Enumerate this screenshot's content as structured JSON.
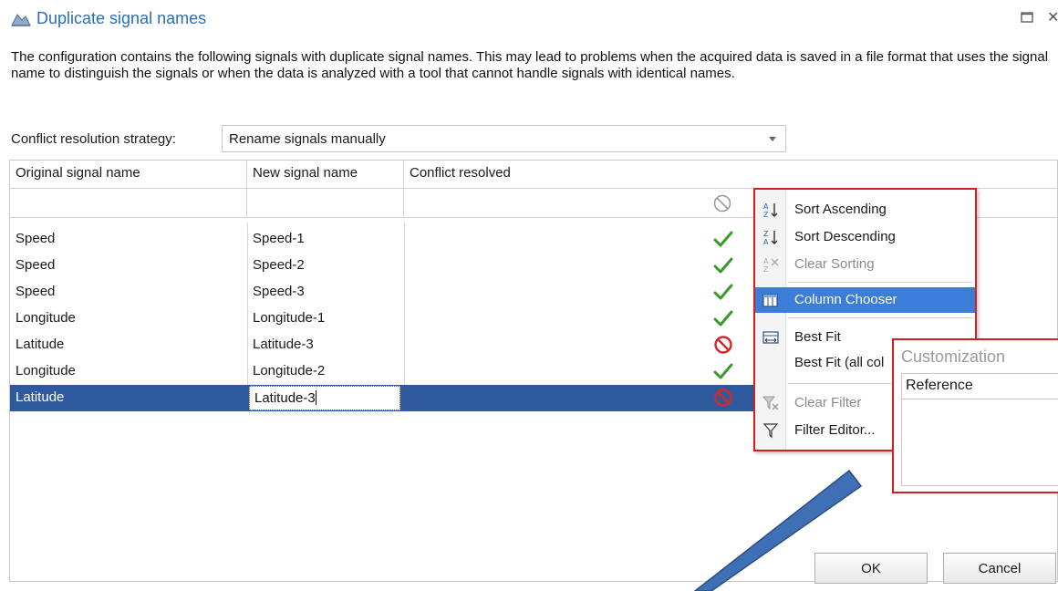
{
  "dialog": {
    "title": "Duplicate signal names",
    "description": "The configuration contains the following signals with duplicate signal names. This may lead to problems when the acquired data is saved in a file format that uses the signal name to distinguish the signals or when the data is analyzed with a tool that cannot handle signals with identical names."
  },
  "strategy": {
    "label": "Conflict resolution strategy:",
    "value": "Rename signals manually"
  },
  "grid": {
    "columns": [
      "Original signal name",
      "New signal name",
      "Conflict resolved"
    ],
    "rows": [
      {
        "original": "Speed",
        "new_name": "Speed-1",
        "resolved": "check"
      },
      {
        "original": "Speed",
        "new_name": "Speed-2",
        "resolved": "check"
      },
      {
        "original": "Speed",
        "new_name": "Speed-3",
        "resolved": "check"
      },
      {
        "original": "Longitude",
        "new_name": "Longitude-1",
        "resolved": "check"
      },
      {
        "original": "Latitude",
        "new_name": "Latitude-3",
        "resolved": "prohibited"
      },
      {
        "original": "Longitude",
        "new_name": "Longitude-2",
        "resolved": "check"
      },
      {
        "original": "Latitude",
        "new_name": "Latitude-3",
        "resolved": "prohibited",
        "selected": true
      }
    ]
  },
  "context_menu": {
    "items": [
      {
        "label": "Sort Ascending",
        "icon": "sort-ascending-icon"
      },
      {
        "label": "Sort Descending",
        "icon": "sort-descending-icon"
      },
      {
        "label": "Clear Sorting",
        "icon": "clear-sorting-icon",
        "disabled": true
      },
      {
        "label": "Column Chooser",
        "icon": "column-chooser-icon",
        "highlighted": true
      },
      {
        "label": "Best Fit",
        "icon": "best-fit-icon"
      },
      {
        "label": "Best Fit (all col",
        "icon": ""
      },
      {
        "label": "Clear Filter",
        "icon": "clear-filter-icon",
        "disabled": true
      },
      {
        "label": "Filter Editor...",
        "icon": "filter-icon"
      }
    ]
  },
  "customization": {
    "title": "Customization",
    "items": [
      "Reference"
    ]
  },
  "buttons": {
    "ok": "OK",
    "cancel": "Cancel"
  },
  "colors": {
    "title": "#2c6db6",
    "selection": "#2f5a9d",
    "menu_highlight": "#3b7dd8",
    "annotation_border": "#d02020",
    "arrow_fill": "#3f6fb4",
    "check": "#3a9a2a",
    "prohibited": "#d22a2a"
  }
}
